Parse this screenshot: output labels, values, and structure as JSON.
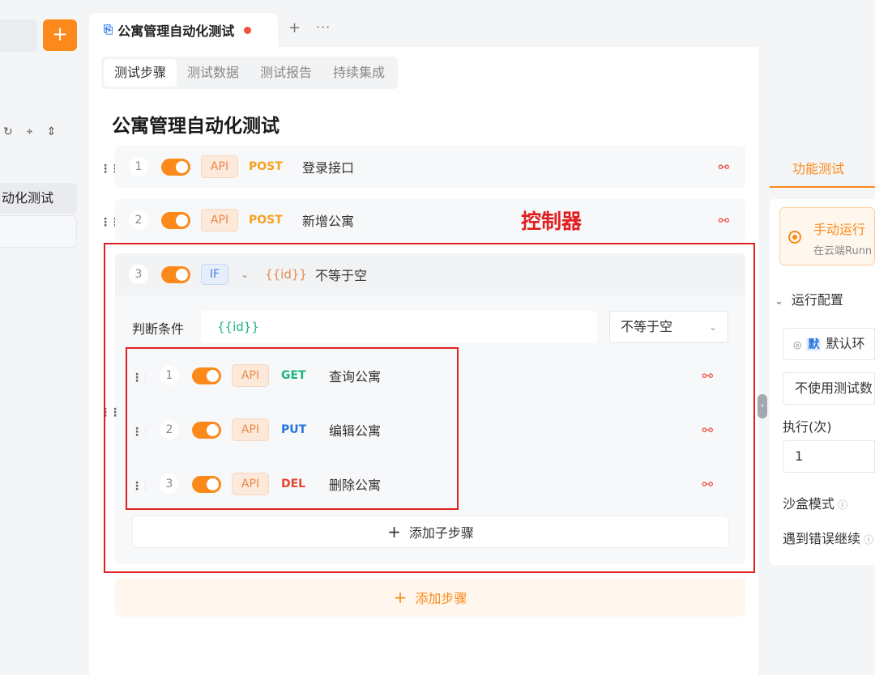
{
  "sidebar": {
    "add_label": "+",
    "item_label": "动化测试"
  },
  "tab": {
    "title": "公寓管理自动化测试",
    "plus": "+",
    "more": "···"
  },
  "subtabs": [
    "测试步骤",
    "测试数据",
    "测试报告",
    "持续集成"
  ],
  "page_title": "公寓管理自动化测试",
  "steps": [
    {
      "num": "1",
      "tag": "API",
      "method": "POST",
      "name": "登录接口"
    },
    {
      "num": "2",
      "tag": "API",
      "method": "POST",
      "name": "新增公寓"
    }
  ],
  "controller_annotation": "控制器",
  "if_step": {
    "num": "3",
    "tag": "IF",
    "var": "{{id}}",
    "op": "不等于空",
    "cond_label": "判断条件",
    "cond_value": "{{id}}",
    "cond_op": "不等于空"
  },
  "children": [
    {
      "num": "1",
      "tag": "API",
      "method": "GET",
      "name": "查询公寓"
    },
    {
      "num": "2",
      "tag": "API",
      "method": "PUT",
      "name": "编辑公寓"
    },
    {
      "num": "3",
      "tag": "API",
      "method": "DEL",
      "name": "删除公寓"
    }
  ],
  "add_substep": "添加子步骤",
  "add_step": "添加步骤",
  "right_panel": {
    "tab": "功能测试",
    "run_title": "手动运行",
    "run_sub": "在云端Runn",
    "config_label": "运行配置",
    "env_badge": "默",
    "env_label": "默认环",
    "data_label": "不使用测试数",
    "exec_label": "执行(次)",
    "exec_value": "1",
    "sandbox": "沙盒模式",
    "continue": "遇到错误继续"
  }
}
